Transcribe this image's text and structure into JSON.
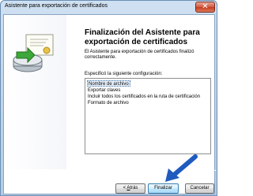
{
  "window": {
    "title": "Asistente para exportación de certificados",
    "close_label": "✕"
  },
  "wizard": {
    "heading": "Finalización del Asistente para exportación de certificados",
    "intro": "El Asistente para exportación de certificados finalizó correctamente.",
    "spec_label": "Especificó la siguiente configuración:",
    "settings": [
      "Nombre de archivo",
      "Exportar claves",
      "Incluir todos los certificados en la ruta de certificación",
      "Formato de archivo"
    ]
  },
  "buttons": {
    "back_prefix": "< ",
    "back_mnemonic": "A",
    "back_rest": "trás",
    "finish": "Finalizar",
    "cancel": "Cancelar"
  },
  "colors": {
    "selection": "#3a6ea5",
    "arrow": "#1f5bbf",
    "primary_border": "#3c7fb1"
  }
}
